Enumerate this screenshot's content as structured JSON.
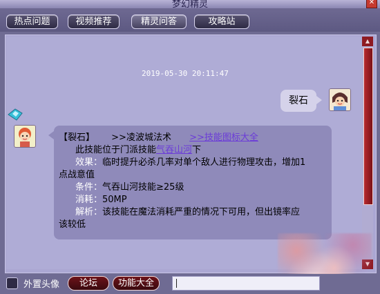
{
  "window": {
    "title": "梦幻精灵"
  },
  "tabs": [
    {
      "label": "热点问题"
    },
    {
      "label": "视频推荐"
    },
    {
      "label": "精灵问答"
    },
    {
      "label": "攻略站"
    }
  ],
  "chat": {
    "timestamp": "2019-05-30 20:11:47",
    "user_message": "裂石",
    "bot": {
      "heading": "【裂石】",
      "school_link": ">>凌波城法术",
      "icon_link": ">>技能图标大全",
      "intro_prefix": "此技能位于门派技能",
      "intro_link": "气吞山河",
      "intro_suffix": "下",
      "effect_label": "效果：",
      "effect_text_1": "临时提升必杀几率对单个敌人进行物理攻击，增加1",
      "effect_text_2": "点战意值",
      "condition_label": "条件：",
      "condition_text": "气吞山河技能≥25级",
      "cost_label": "消耗：",
      "cost_text": "50MP",
      "analysis_label": "解析：",
      "analysis_text_1": "该技能在魔法消耗严重的情况下可用，但出镜率应",
      "analysis_text_2": "该较低"
    }
  },
  "bottom": {
    "avatar_checkbox_label": "外置头像",
    "forum_button": "论坛",
    "features_button": "功能大全",
    "input_value": ""
  },
  "colors": {
    "accent": "#8e1a22",
    "link": "#6b3bd8",
    "panel": "#afacd6"
  }
}
